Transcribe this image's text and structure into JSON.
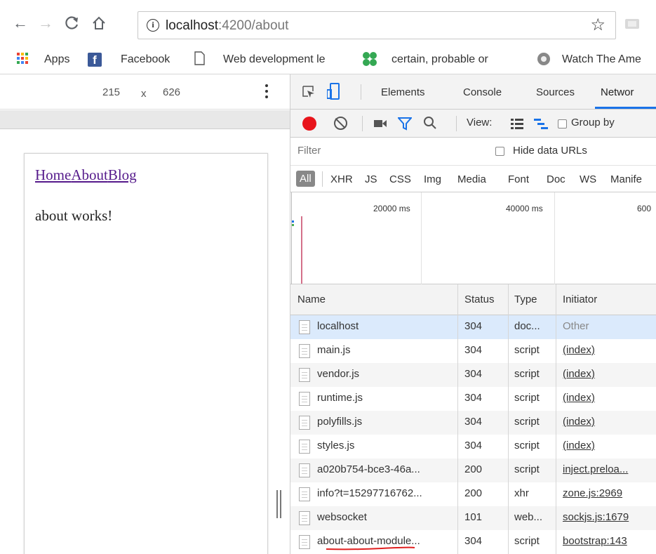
{
  "toolbar": {
    "back_icon": "←",
    "forward_icon": "→",
    "reload_icon": "C",
    "home_icon": "⌂",
    "url_host": "localhost",
    "url_path": ":4200/about",
    "star_icon": "☆"
  },
  "bookmarks": {
    "apps_label": "Apps",
    "facebook_glyph": "f",
    "facebook_label": "Facebook",
    "webdev_label": "Web development le",
    "certain_label": "certain, probable or",
    "watch_label": "Watch The Ame"
  },
  "device": {
    "width": "215",
    "times": "x",
    "height": "626"
  },
  "page": {
    "links": [
      "Home",
      "About",
      "Blog"
    ],
    "body_text": "about works!"
  },
  "devtools": {
    "tabs": [
      "Elements",
      "Console",
      "Sources",
      "Networ"
    ],
    "view_label": "View:",
    "group_label": "Group by",
    "filter_placeholder": "Filter",
    "hide_data_urls": "Hide data URLs",
    "types": [
      "All",
      "XHR",
      "JS",
      "CSS",
      "Img",
      "Media",
      "Font",
      "Doc",
      "WS",
      "Manife"
    ],
    "timeline_labels": [
      "20000 ms",
      "40000 ms",
      "600"
    ]
  },
  "network": {
    "headers": {
      "name": "Name",
      "status": "Status",
      "type": "Type",
      "initiator": "Initiator"
    },
    "rows": [
      {
        "name": "localhost",
        "status": "304",
        "type": "doc...",
        "initiator": "Other"
      },
      {
        "name": "main.js",
        "status": "304",
        "type": "script",
        "initiator": "(index)"
      },
      {
        "name": "vendor.js",
        "status": "304",
        "type": "script",
        "initiator": "(index)"
      },
      {
        "name": "runtime.js",
        "status": "304",
        "type": "script",
        "initiator": "(index)"
      },
      {
        "name": "polyfills.js",
        "status": "304",
        "type": "script",
        "initiator": "(index)"
      },
      {
        "name": "styles.js",
        "status": "304",
        "type": "script",
        "initiator": "(index)"
      },
      {
        "name": "a020b754-bce3-46a...",
        "status": "200",
        "type": "script",
        "initiator": "inject.preloa..."
      },
      {
        "name": "info?t=15297716762...",
        "status": "200",
        "type": "xhr",
        "initiator": "zone.js:2969"
      },
      {
        "name": "websocket",
        "status": "101",
        "type": "web...",
        "initiator": "sockjs.js:1679"
      },
      {
        "name": "about-about-module...",
        "status": "304",
        "type": "script",
        "initiator": "bootstrap:143"
      }
    ]
  },
  "colors": {
    "record": "#e8141b",
    "link_visited": "#551a8b",
    "selected_row": "#dbeafc",
    "accent": "#1a73e8"
  }
}
